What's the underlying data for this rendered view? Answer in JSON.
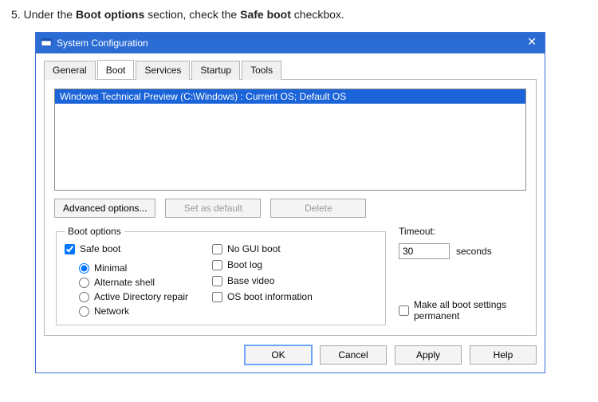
{
  "instruction": {
    "number": "5.",
    "prefix": "Under the ",
    "bold1": "Boot options",
    "mid": " section, check the ",
    "bold2": "Safe boot",
    "suffix": " checkbox."
  },
  "window": {
    "title": "System Configuration",
    "tabs": {
      "general": "General",
      "boot": "Boot",
      "services": "Services",
      "startup": "Startup",
      "tools": "Tools"
    },
    "oslist": {
      "item0": "Windows Technical Preview (C:\\Windows) : Current OS; Default OS"
    },
    "buttons": {
      "advanced": "Advanced options...",
      "set_default": "Set as default",
      "delete": "Delete",
      "ok": "OK",
      "cancel": "Cancel",
      "apply": "Apply",
      "help": "Help"
    },
    "bootopts": {
      "legend": "Boot options",
      "safeboot": "Safe boot",
      "minimal": "Minimal",
      "altshell": "Alternate shell",
      "adrepair": "Active Directory repair",
      "network": "Network",
      "nogui": "No GUI boot",
      "bootlog": "Boot log",
      "basevid": "Base video",
      "osinfo": "OS boot information"
    },
    "timeout": {
      "label": "Timeout:",
      "value": "30",
      "unit": "seconds"
    },
    "permanent": "Make all boot settings permanent"
  }
}
